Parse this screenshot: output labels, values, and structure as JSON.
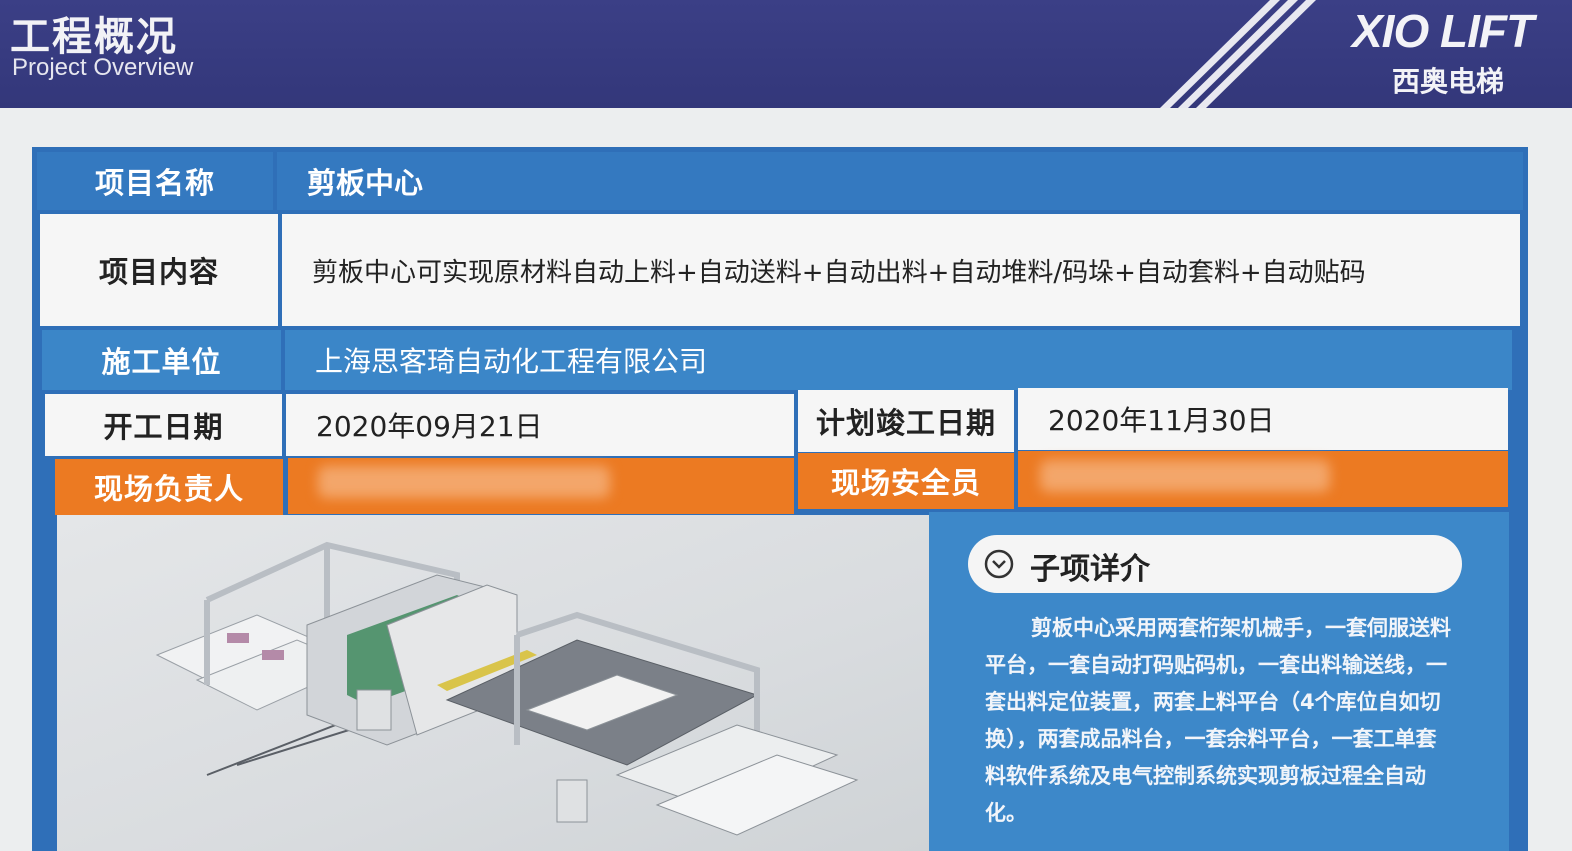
{
  "header": {
    "title_cn": "工程概况",
    "title_en": "Project Overview",
    "brand_en": "XIO LIFT",
    "brand_cn": "西奥电梯"
  },
  "table": {
    "project_name_label": "项目名称",
    "project_name_value": "剪板中心",
    "project_content_label": "项目内容",
    "project_content_value": "剪板中心可实现原材料自动上料+自动送料+自动出料+自动堆料/码垛+自动套料+自动贴码",
    "contractor_label": "施工单位",
    "contractor_value": "上海思客琦自动化工程有限公司",
    "start_date_label": "开工日期",
    "start_date_value": "2020年09月21日",
    "planned_completion_label": "计划竣工日期",
    "planned_completion_value": "2020年11月30日",
    "site_manager_label": "现场负责人",
    "safety_officer_label": "现场安全员"
  },
  "subitem": {
    "title": "子项详介",
    "description": "剪板中心采用两套桁架机械手，一套伺服送料平台，一套自动打码贴码机，一套出料输送线，一套出料定位装置，两套上料平台（4个库位自如切换），两套成品料台，一套余料平台，一套工单套料软件系统及电气控制系统实现剪板过程全自动化。"
  },
  "colors": {
    "header_bg": "#363a7e",
    "table_blue": "#3479c0",
    "table_orange": "#ec7a22",
    "info_blue": "#3d88c9"
  }
}
